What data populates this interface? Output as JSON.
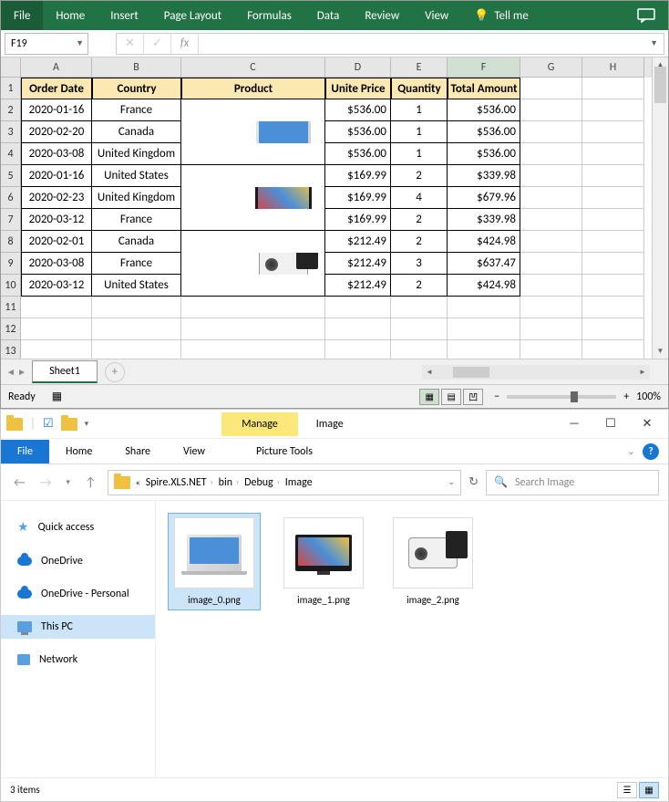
{
  "excel": {
    "ribbon": [
      "File",
      "Home",
      "Insert",
      "Page Layout",
      "Formulas",
      "Data",
      "Review",
      "View"
    ],
    "tellme": "Tell me",
    "namebox": "F19",
    "fx": "fx",
    "cols": [
      "A",
      "B",
      "C",
      "D",
      "E",
      "F",
      "G",
      "H"
    ],
    "rows": [
      1,
      2,
      3,
      4,
      5,
      6,
      7,
      8,
      9,
      10,
      11,
      12,
      13
    ],
    "headers": [
      "Order Date",
      "Country",
      "Product",
      "Unite Price",
      "Quantity",
      "Total Amount"
    ],
    "data": [
      {
        "date": "2020-01-16",
        "country": "France",
        "product": "Laptop",
        "price": "$536.00",
        "qty": "1",
        "total": "$536.00",
        "pspan": "start"
      },
      {
        "date": "2020-02-20",
        "country": "Canada",
        "product": "",
        "price": "$536.00",
        "qty": "1",
        "total": "$536.00",
        "pspan": "mid"
      },
      {
        "date": "2020-03-08",
        "country": "United Kingdom",
        "product": "",
        "price": "$536.00",
        "qty": "1",
        "total": "$536.00",
        "pspan": "end"
      },
      {
        "date": "2020-01-16",
        "country": "United States",
        "product": "Samrt TV",
        "price": "$169.99",
        "qty": "2",
        "total": "$339.98",
        "pspan": "start"
      },
      {
        "date": "2020-02-23",
        "country": "United Kingdom",
        "product": "",
        "price": "$169.99",
        "qty": "4",
        "total": "$679.96",
        "pspan": "mid"
      },
      {
        "date": "2020-03-12",
        "country": "France",
        "product": "",
        "price": "$169.99",
        "qty": "2",
        "total": "$339.98",
        "pspan": "end"
      },
      {
        "date": "2020-02-01",
        "country": "Canada",
        "product": "Projector",
        "price": "$212.49",
        "qty": "2",
        "total": "$424.98",
        "pspan": "start"
      },
      {
        "date": "2020-03-08",
        "country": "France",
        "product": "",
        "price": "$212.49",
        "qty": "3",
        "total": "$637.47",
        "pspan": "mid"
      },
      {
        "date": "2020-03-12",
        "country": "United States",
        "product": "",
        "price": "$212.49",
        "qty": "2",
        "total": "$424.98",
        "pspan": "end"
      }
    ],
    "sheet": "Sheet1",
    "status": "Ready",
    "zoom": "100%"
  },
  "explorer": {
    "manage": "Manage",
    "title": "Image",
    "picturetools": "Picture Tools",
    "tabs": {
      "file": "File",
      "home": "Home",
      "share": "Share",
      "view": "View"
    },
    "breadcrumb": [
      "Spire.XLS.NET",
      "bin",
      "Debug",
      "Image"
    ],
    "search_ph": "Search Image",
    "nav": {
      "quick": "Quick access",
      "od": "OneDrive",
      "odp": "OneDrive - Personal",
      "pc": "This PC",
      "net": "Network"
    },
    "files": [
      "image_0.png",
      "image_1.png",
      "image_2.png"
    ],
    "status": "3 items",
    "refresh": "↻"
  }
}
